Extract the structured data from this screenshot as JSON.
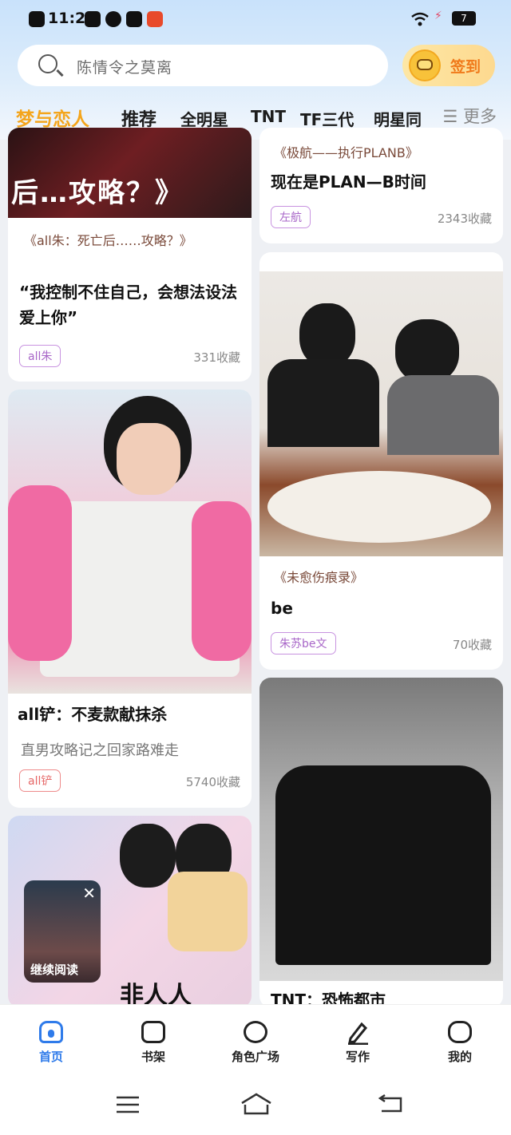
{
  "status": {
    "time": "11:23",
    "battery": "7"
  },
  "search": {
    "placeholder": "陈情令之莫离"
  },
  "signin": {
    "label": "签到"
  },
  "tabs": [
    "梦与恋人",
    "推荐",
    "全明星",
    "TNT",
    "TF三代",
    "明星同"
  ],
  "tabs_more": "☰ 更多",
  "left_cards": [
    {
      "cover_text": "后…攻略？》",
      "subtitle": "《all朱：死亡后……攻略？》",
      "headline": "“我控制不住自己，会想法设法爱上你”",
      "tag": "all朱",
      "favorites": "331收藏"
    },
    {
      "title": "all铲：不麦款献抹杀",
      "desc": "直男攻略记之回家路难走",
      "tag": "all铲",
      "favorites": "5740收藏"
    },
    {
      "cover_text": "非人人"
    }
  ],
  "right_cards": [
    {
      "subtitle": "《极航——执行PLANB》",
      "headline": "现在是PLAN—B时间",
      "tag": "左航",
      "favorites": "2343收藏"
    },
    {
      "subtitle": "《未愈伤痕录》",
      "headline": "be",
      "tag": "朱苏be文",
      "favorites": "70收藏"
    },
    {
      "title": "TNT：恐怖都市"
    }
  ],
  "float_bubble": {
    "label": "继续阅读",
    "close": "✕"
  },
  "bottom_nav": [
    {
      "label": "首页",
      "icon": "home-icon"
    },
    {
      "label": "书架",
      "icon": "bookshelf-icon"
    },
    {
      "label": "角色广场",
      "icon": "planet-icon"
    },
    {
      "label": "写作",
      "icon": "pen-icon"
    },
    {
      "label": "我的",
      "icon": "chat-bubble-icon"
    }
  ]
}
